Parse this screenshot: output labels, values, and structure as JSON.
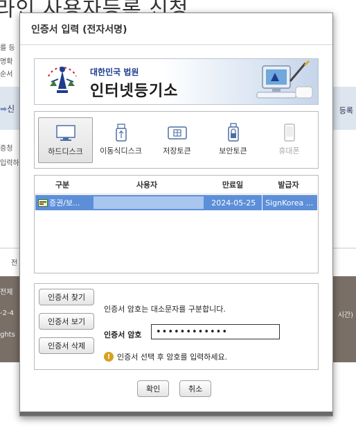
{
  "background": {
    "title": "라인 사용자등록 신청",
    "left_lines": [
      "를 등",
      "명확",
      "순서"
    ],
    "band_left": "신",
    "band_right": "등록",
    "left_lines2": [
      "증청",
      "입력하"
    ],
    "mid_text": "전",
    "footer_lines": [
      "전제",
      "-2-4",
      "ghts"
    ],
    "footer_right": "시간)"
  },
  "dialog": {
    "title": "인증서 입력 (전자서명)",
    "banner": {
      "org": "대한민국 법원",
      "service": "인터넷등기소"
    },
    "media": [
      {
        "label": "하드디스크",
        "selected": true,
        "enabled": true,
        "icon": "monitor-icon"
      },
      {
        "label": "이동식디스크",
        "selected": false,
        "enabled": true,
        "icon": "usb-icon"
      },
      {
        "label": "저장토큰",
        "selected": false,
        "enabled": true,
        "icon": "token-icon"
      },
      {
        "label": "보안토큰",
        "selected": false,
        "enabled": true,
        "icon": "security-token-icon"
      },
      {
        "label": "휴대폰",
        "selected": false,
        "enabled": false,
        "icon": "phone-icon"
      }
    ],
    "table": {
      "headers": [
        "구분",
        "사용자",
        "만료일",
        "발급자"
      ],
      "rows": [
        {
          "type": "증권/보...",
          "user": "",
          "expiry": "2024-05-25",
          "issuer": "SignKorea ..."
        }
      ]
    },
    "buttons": {
      "find": "인증서 찾기",
      "view": "인증서 보기",
      "delete": "인증서 삭제",
      "ok": "확인",
      "cancel": "취소"
    },
    "case_note": "인증서 암호는 대소문자를 구분합니다.",
    "password_label": "인증서 암호",
    "password_value": "••••••••••••",
    "warning": "인증서 선택 후 암호를 입력하세요."
  },
  "colors": {
    "selected_row": "#5d8fd9",
    "accent": "#1e3d8c",
    "warning": "#d8a01e"
  }
}
